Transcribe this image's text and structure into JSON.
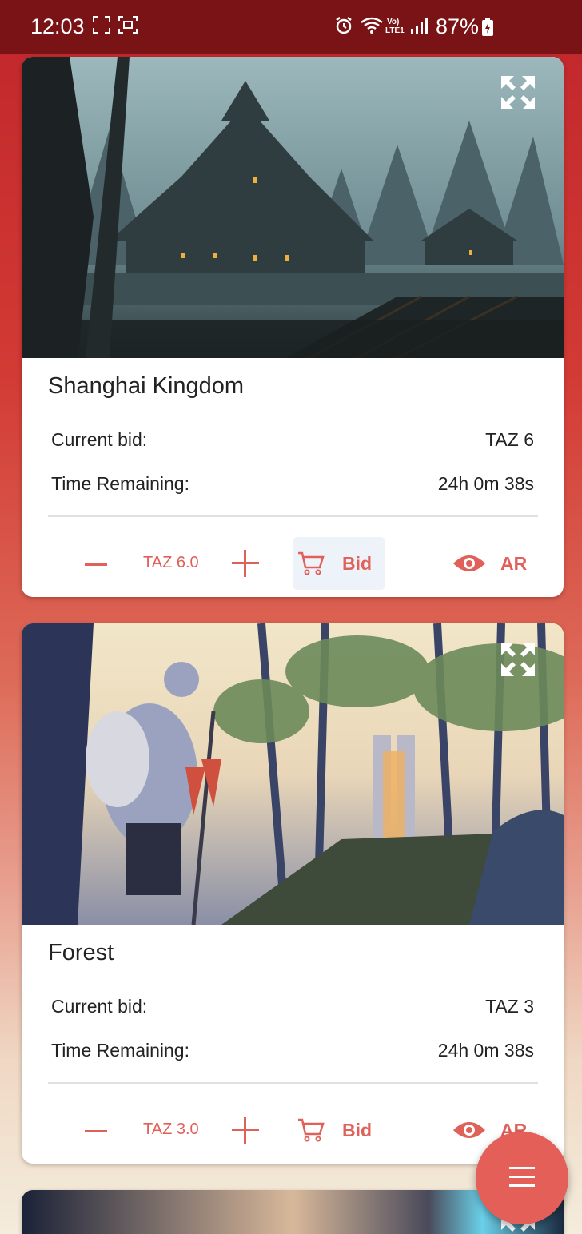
{
  "status_bar": {
    "time": "12:03",
    "battery": "87%",
    "icons": [
      "screenshot-frame-icon",
      "screen-capture-icon",
      "alarm-icon",
      "wifi-icon",
      "volte-icon",
      "signal-icon",
      "battery-charging-icon"
    ]
  },
  "theme": {
    "accent": "#e0605a",
    "status_bar_bg": "#7a1316",
    "fab_bg": "#e35f58"
  },
  "cards": [
    {
      "title": "Shanghai Kingdom",
      "current_bid_label": "Current bid:",
      "current_bid_value": "TAZ 6",
      "time_label": "Time Remaining:",
      "time_value": "24h 0m 38s",
      "amount": "TAZ 6.0",
      "bid_label": "Bid",
      "ar_label": "AR",
      "image_icon": "fantasy-village-artwork"
    },
    {
      "title": "Forest",
      "current_bid_label": "Current bid:",
      "current_bid_value": "TAZ 3",
      "time_label": "Time Remaining:",
      "time_value": "24h 0m 38s",
      "amount": "TAZ 3.0",
      "bid_label": "Bid",
      "ar_label": "AR",
      "image_icon": "forest-warrior-artwork"
    }
  ],
  "fab": {
    "icon": "menu-icon"
  }
}
